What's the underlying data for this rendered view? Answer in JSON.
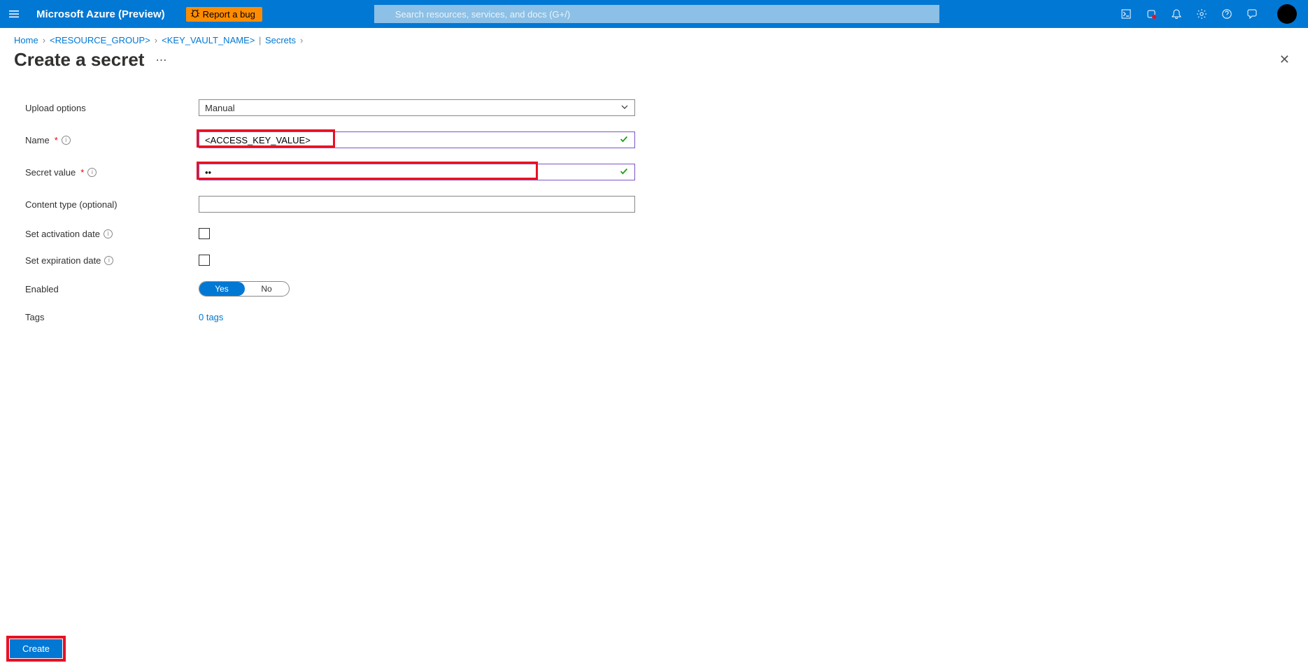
{
  "topbar": {
    "portal_name": "Microsoft Azure (Preview)",
    "report_bug": "Report a bug",
    "search_placeholder": "Search resources, services, and docs (G+/)"
  },
  "breadcrumbs": {
    "home": "Home",
    "resource_group": "<RESOURCE_GROUP>",
    "keyvault": "<KEY_VAULT_NAME>",
    "secrets": "Secrets"
  },
  "page": {
    "title": "Create a secret"
  },
  "form": {
    "upload_options": {
      "label": "Upload options",
      "value": "Manual"
    },
    "name": {
      "label": "Name",
      "value": "<ACCESS_KEY_VALUE>"
    },
    "secret_value": {
      "label": "Secret value",
      "value": "••"
    },
    "content_type": {
      "label": "Content type (optional)",
      "value": ""
    },
    "activation": {
      "label": "Set activation date"
    },
    "expiration": {
      "label": "Set expiration date"
    },
    "enabled": {
      "label": "Enabled",
      "yes": "Yes",
      "no": "No"
    },
    "tags": {
      "label": "Tags",
      "link": "0 tags"
    }
  },
  "footer": {
    "create": "Create"
  }
}
